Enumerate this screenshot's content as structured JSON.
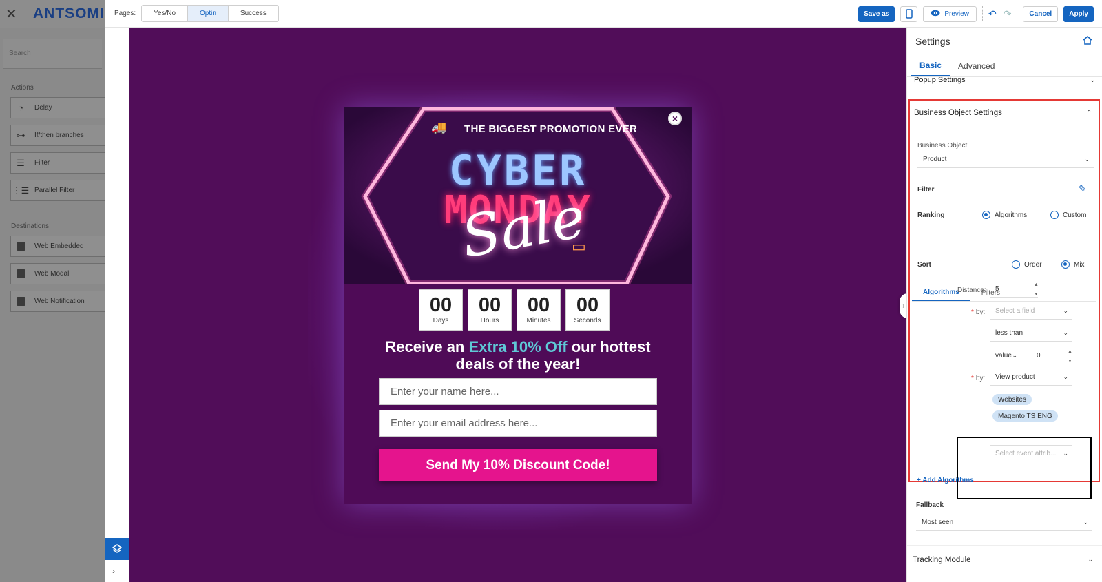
{
  "left_panel": {
    "logo": "ANTSOMI",
    "search_placeholder": "Search",
    "actions_label": "Actions",
    "actions": [
      "Delay",
      "If/then branches",
      "Filter",
      "Parallel Filter"
    ],
    "destinations_label": "Destinations",
    "destinations": [
      "Web Embedded",
      "Web Modal",
      "Web Notification"
    ]
  },
  "toolbar": {
    "pages_label": "Pages:",
    "pages": [
      "Yes/No",
      "Optin",
      "Success"
    ],
    "active_page": "Optin",
    "save_as": "Save as",
    "preview": "Preview",
    "cancel": "Cancel",
    "apply": "Apply"
  },
  "popup": {
    "tagline": "THE BIGGEST PROMOTION EVER",
    "hero_line1": "CYBER",
    "hero_line2": "MONDAY",
    "hero_script": "Sale",
    "countdown": [
      {
        "value": "00",
        "label": "Days"
      },
      {
        "value": "00",
        "label": "Hours"
      },
      {
        "value": "00",
        "label": "Minutes"
      },
      {
        "value": "00",
        "label": "Seconds"
      }
    ],
    "headline_pre": "Receive an",
    "headline_highlight": "Extra 10% Off",
    "headline_post": "our hottest",
    "headline_line2": "deals of the year!",
    "name_placeholder": "Enter your name here...",
    "email_placeholder": "Enter your email address here...",
    "cta": "Send My 10% Discount Code!"
  },
  "settings": {
    "title": "Settings",
    "tabs": [
      "Basic",
      "Advanced"
    ],
    "popup_settings": "Popup Settings",
    "bos_title": "Business Object Settings",
    "business_object_label": "Business Object",
    "business_object_value": "Product",
    "filter_label": "Filter",
    "ranking_label": "Ranking",
    "ranking_options": [
      "Algorithms",
      "Custom"
    ],
    "subtabs": [
      "Algorithms",
      "Filters"
    ],
    "sort_label": "Sort",
    "sort_options": [
      "Order",
      "Mix"
    ],
    "distance_label": "Distance:",
    "distance_value": "5",
    "by_label": "by:",
    "by1_placeholder": "Select a field",
    "operator_value": "less than",
    "value_type": "value",
    "value_number": "0",
    "by2_value": "View product",
    "chips": [
      "Websites",
      "Magento TS ENG"
    ],
    "event_attr_placeholder": "Select event attrib...",
    "add_algorithms": "+ Add Algorithms",
    "fallback_label": "Fallback",
    "fallback_value": "Most seen",
    "tracking_module": "Tracking Module"
  }
}
